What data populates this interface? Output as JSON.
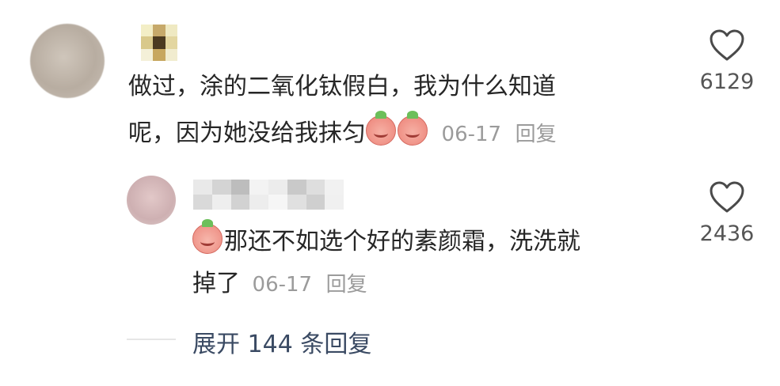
{
  "comment": {
    "text_line1": "做过，涂的二氧化钛假白，我为什么知道",
    "text_line2": "呢，因为她没给我抹匀",
    "date": "06-17",
    "reply_label": "回复",
    "like_count": "6129"
  },
  "reply": {
    "text_line1": "那还不如选个好的素颜霜，洗洗就",
    "text_line2": "掉了",
    "date": "06-17",
    "reply_label": "回复",
    "like_count": "2436"
  },
  "expand": {
    "label": "展开 144 条回复"
  },
  "colors": {
    "text": "#262626",
    "meta": "#9b9b9b",
    "link": "#3a4a63",
    "icon": "#4a4a4a"
  },
  "icons": [
    "heart-icon",
    "laugh-cry-emoji",
    "crying-emoji"
  ]
}
